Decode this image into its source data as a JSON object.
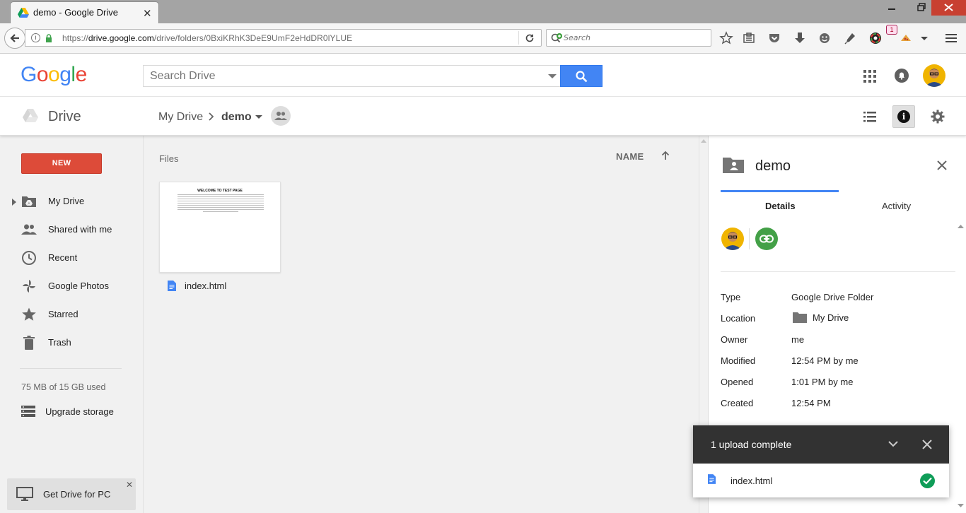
{
  "browser": {
    "tab_title": "demo - Google Drive",
    "tab_close": "✕",
    "url_prefix": "https://",
    "url_host": "drive.google.com",
    "url_path": "/drive/folders/0BxiKRhK3DeE9UmF2eHdDR0lYLUE",
    "search_placeholder": "Search",
    "badge_count": "1",
    "info_glyph": "i"
  },
  "header": {
    "logo": [
      "G",
      "o",
      "o",
      "g",
      "l",
      "e"
    ],
    "search_placeholder": "Search Drive"
  },
  "toolbar": {
    "app_name": "Drive",
    "breadcrumb_root": "My Drive",
    "breadcrumb_current": "demo"
  },
  "sidebar": {
    "new_button": "NEW",
    "items": [
      {
        "label": "My Drive",
        "icon": "my-drive-icon"
      },
      {
        "label": "Shared with me",
        "icon": "shared-icon"
      },
      {
        "label": "Recent",
        "icon": "clock-icon"
      },
      {
        "label": "Google Photos",
        "icon": "photos-icon"
      },
      {
        "label": "Starred",
        "icon": "star-icon"
      },
      {
        "label": "Trash",
        "icon": "trash-icon"
      }
    ],
    "quota": "75 MB of 15 GB used",
    "upgrade": "Upgrade storage",
    "get_drive": "Get Drive for PC",
    "get_drive_close": "✕"
  },
  "main": {
    "section_label": "Files",
    "sort_label": "NAME",
    "files": [
      {
        "name": "index.html",
        "thumb_title": "WELCOME TO TEST PAGE"
      }
    ]
  },
  "details": {
    "title": "demo",
    "tabs": [
      "Details",
      "Activity"
    ],
    "active_tab": "Details",
    "properties": [
      {
        "key": "Type",
        "value": "Google Drive Folder"
      },
      {
        "key": "Location",
        "value": "My Drive"
      },
      {
        "key": "Owner",
        "value": "me"
      },
      {
        "key": "Modified",
        "value": "12:54 PM by me"
      },
      {
        "key": "Opened",
        "value": "1:01 PM by me"
      },
      {
        "key": "Created",
        "value": "12:54 PM"
      }
    ]
  },
  "upload": {
    "title": "1 upload complete",
    "items": [
      {
        "name": "index.html",
        "status": "complete"
      }
    ]
  },
  "colors": {
    "accent": "#4285f4",
    "new_button": "#dd4b39",
    "link_share": "#43a047",
    "upload_ok": "#0f9d58",
    "upload_header": "#323232"
  }
}
